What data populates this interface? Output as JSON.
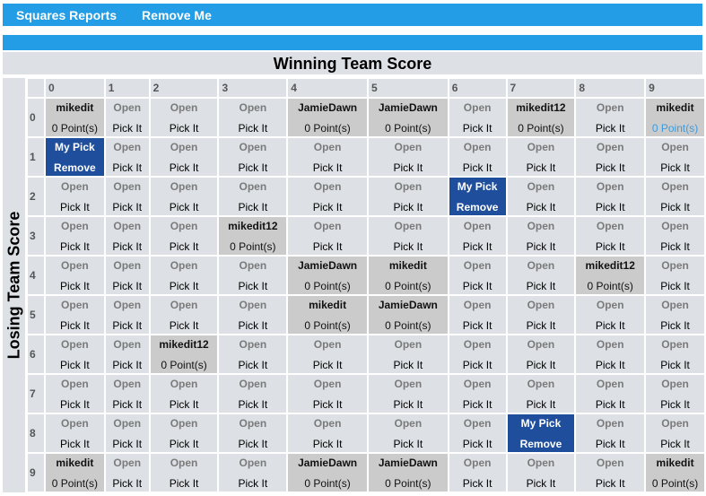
{
  "nav": {
    "items": [
      {
        "label": "Squares Reports"
      },
      {
        "label": "Remove Me"
      }
    ]
  },
  "winning_label": "Winning Team Score",
  "losing_label": "Losing Team Score",
  "columns": [
    "0",
    "1",
    "2",
    "3",
    "4",
    "5",
    "6",
    "7",
    "8",
    "9"
  ],
  "rows": [
    "0",
    "1",
    "2",
    "3",
    "4",
    "5",
    "6",
    "7",
    "8",
    "9"
  ],
  "labels": {
    "open": "Open",
    "pick": "Pick It",
    "mine_top": "My Pick",
    "mine_bottom": "Remove",
    "points": "0 Point(s)"
  },
  "colors": {
    "nav": "#229de6",
    "cell": "#dde1e5",
    "taken": "#cbcbcb",
    "mine": "#1f4e9c"
  },
  "grid": [
    [
      {
        "s": "taken",
        "name": "mikedit"
      },
      {
        "s": "open"
      },
      {
        "s": "open"
      },
      {
        "s": "open"
      },
      {
        "s": "taken",
        "name": "JamieDawn"
      },
      {
        "s": "taken",
        "name": "JamieDawn"
      },
      {
        "s": "open"
      },
      {
        "s": "taken",
        "name": "mikedit12"
      },
      {
        "s": "open"
      },
      {
        "s": "taken",
        "name": "mikedit",
        "highlight": true
      }
    ],
    [
      {
        "s": "mine"
      },
      {
        "s": "open"
      },
      {
        "s": "open"
      },
      {
        "s": "open"
      },
      {
        "s": "open"
      },
      {
        "s": "open"
      },
      {
        "s": "open"
      },
      {
        "s": "open"
      },
      {
        "s": "open"
      },
      {
        "s": "open"
      }
    ],
    [
      {
        "s": "open"
      },
      {
        "s": "open"
      },
      {
        "s": "open"
      },
      {
        "s": "open"
      },
      {
        "s": "open"
      },
      {
        "s": "open"
      },
      {
        "s": "mine"
      },
      {
        "s": "open"
      },
      {
        "s": "open"
      },
      {
        "s": "open"
      }
    ],
    [
      {
        "s": "open"
      },
      {
        "s": "open"
      },
      {
        "s": "open"
      },
      {
        "s": "taken",
        "name": "mikedit12"
      },
      {
        "s": "open"
      },
      {
        "s": "open"
      },
      {
        "s": "open"
      },
      {
        "s": "open"
      },
      {
        "s": "open"
      },
      {
        "s": "open"
      }
    ],
    [
      {
        "s": "open"
      },
      {
        "s": "open"
      },
      {
        "s": "open"
      },
      {
        "s": "open"
      },
      {
        "s": "taken",
        "name": "JamieDawn"
      },
      {
        "s": "taken",
        "name": "mikedit"
      },
      {
        "s": "open"
      },
      {
        "s": "open"
      },
      {
        "s": "taken",
        "name": "mikedit12"
      },
      {
        "s": "open"
      }
    ],
    [
      {
        "s": "open"
      },
      {
        "s": "open"
      },
      {
        "s": "open"
      },
      {
        "s": "open"
      },
      {
        "s": "taken",
        "name": "mikedit"
      },
      {
        "s": "taken",
        "name": "JamieDawn"
      },
      {
        "s": "open"
      },
      {
        "s": "open"
      },
      {
        "s": "open"
      },
      {
        "s": "open"
      }
    ],
    [
      {
        "s": "open"
      },
      {
        "s": "open"
      },
      {
        "s": "taken",
        "name": "mikedit12"
      },
      {
        "s": "open"
      },
      {
        "s": "open"
      },
      {
        "s": "open"
      },
      {
        "s": "open"
      },
      {
        "s": "open"
      },
      {
        "s": "open"
      },
      {
        "s": "open"
      }
    ],
    [
      {
        "s": "open"
      },
      {
        "s": "open"
      },
      {
        "s": "open"
      },
      {
        "s": "open"
      },
      {
        "s": "open"
      },
      {
        "s": "open"
      },
      {
        "s": "open"
      },
      {
        "s": "open"
      },
      {
        "s": "open"
      },
      {
        "s": "open"
      }
    ],
    [
      {
        "s": "open"
      },
      {
        "s": "open"
      },
      {
        "s": "open"
      },
      {
        "s": "open"
      },
      {
        "s": "open"
      },
      {
        "s": "open"
      },
      {
        "s": "open"
      },
      {
        "s": "mine"
      },
      {
        "s": "open"
      },
      {
        "s": "open"
      }
    ],
    [
      {
        "s": "taken",
        "name": "mikedit"
      },
      {
        "s": "open"
      },
      {
        "s": "open"
      },
      {
        "s": "open"
      },
      {
        "s": "taken",
        "name": "JamieDawn"
      },
      {
        "s": "taken",
        "name": "JamieDawn"
      },
      {
        "s": "open"
      },
      {
        "s": "open"
      },
      {
        "s": "open"
      },
      {
        "s": "taken",
        "name": "mikedit"
      }
    ]
  ]
}
